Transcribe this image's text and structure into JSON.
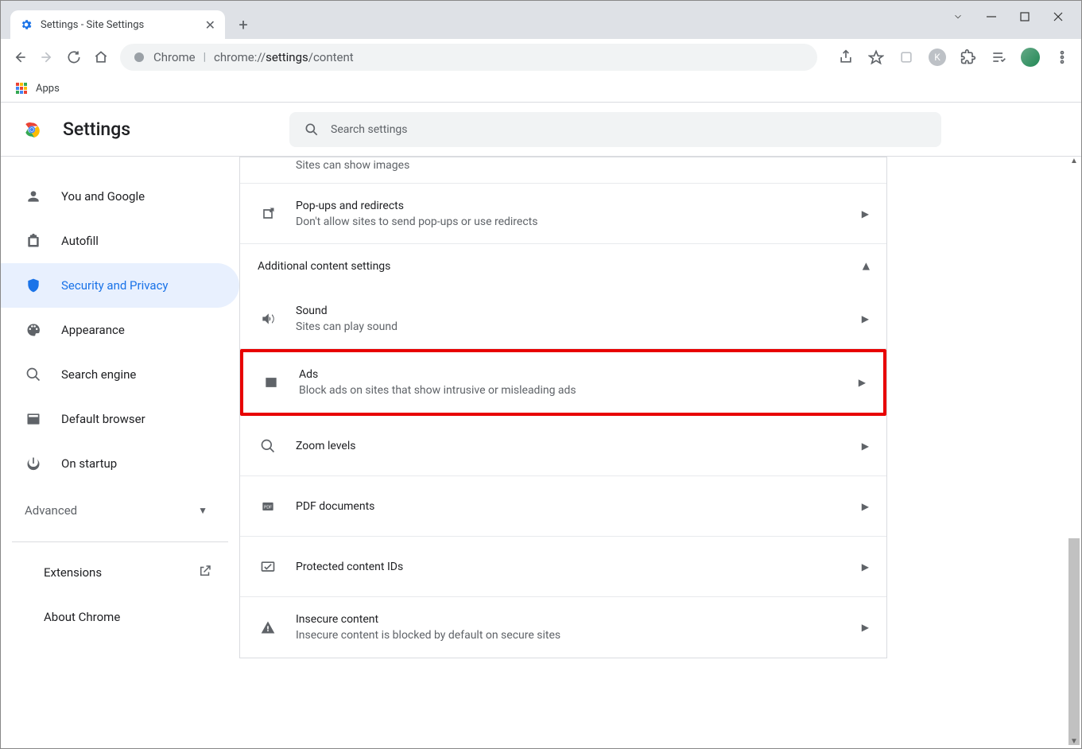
{
  "window": {
    "tab_title": "Settings - Site Settings"
  },
  "omnibox": {
    "label": "Chrome",
    "url_prefix": "chrome://",
    "url_bold": "settings",
    "url_tail": "/content"
  },
  "bookmarks": {
    "apps": "Apps"
  },
  "header": {
    "title": "Settings",
    "search_placeholder": "Search settings"
  },
  "sidebar": {
    "items": [
      {
        "label": "You and Google"
      },
      {
        "label": "Autofill"
      },
      {
        "label": "Security and Privacy"
      },
      {
        "label": "Appearance"
      },
      {
        "label": "Search engine"
      },
      {
        "label": "Default browser"
      },
      {
        "label": "On startup"
      }
    ],
    "advanced": "Advanced",
    "extensions": "Extensions",
    "about": "About Chrome"
  },
  "content": {
    "partial_images_sub": "Sites can show images",
    "rows": [
      {
        "title": "Pop-ups and redirects",
        "sub": "Don't allow sites to send pop-ups or use redirects",
        "icon": "popup"
      },
      {
        "section": "Additional content settings"
      },
      {
        "title": "Sound",
        "sub": "Sites can play sound",
        "icon": "sound"
      },
      {
        "title": "Ads",
        "sub": "Block ads on sites that show intrusive or misleading ads",
        "icon": "ads",
        "highlight": true
      },
      {
        "title": "Zoom levels",
        "icon": "zoom"
      },
      {
        "title": "PDF documents",
        "icon": "pdf"
      },
      {
        "title": "Protected content IDs",
        "icon": "protected"
      },
      {
        "title": "Insecure content",
        "sub": "Insecure content is blocked by default on secure sites",
        "icon": "warning"
      }
    ]
  }
}
